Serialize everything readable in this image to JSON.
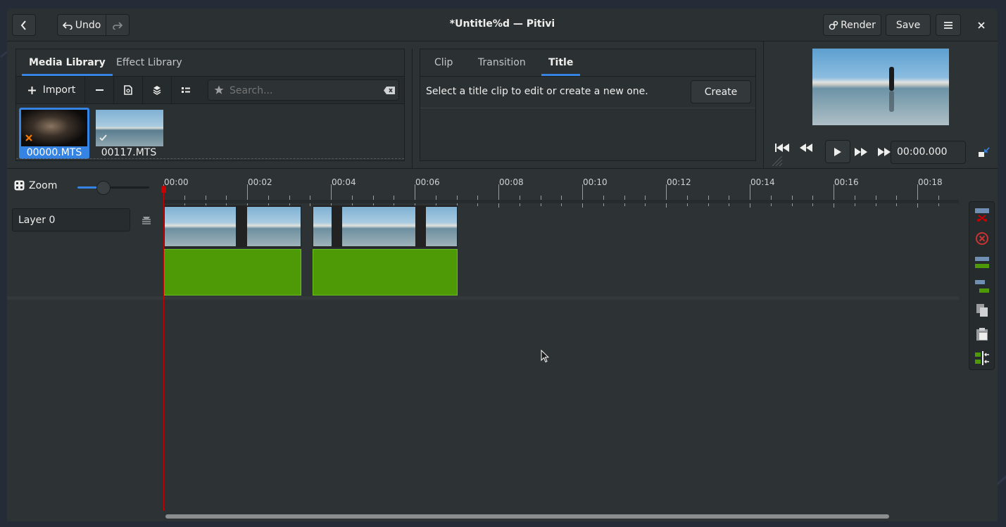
{
  "window": {
    "title": "*Untitle%d — Pitivi"
  },
  "header": {
    "back_icon": "go-back-icon",
    "undo_label": "Undo",
    "redo_icon": "redo-icon",
    "render_label": "Render",
    "save_label": "Save",
    "menu_icon": "hamburger-menu-icon",
    "close_icon": "close-icon"
  },
  "library": {
    "tabs": [
      {
        "label": "Media Library",
        "active": true
      },
      {
        "label": "Effect Library",
        "active": false
      }
    ],
    "import_label": "Import",
    "search_placeholder": "Search...",
    "clips": [
      {
        "name": "00000.MTS",
        "selected": true,
        "status": "error"
      },
      {
        "name": "00117.MTS",
        "selected": false,
        "status": "ok"
      }
    ]
  },
  "context": {
    "tabs": [
      {
        "label": "Clip"
      },
      {
        "label": "Transition"
      },
      {
        "label": "Title",
        "active": true
      }
    ],
    "message": "Select a title clip to edit or create a new one.",
    "create_label": "Create"
  },
  "viewer": {
    "time": "00:00.000"
  },
  "timeline": {
    "zoom_label": "Zoom",
    "zoom_level": 0.33,
    "ruler_labels": [
      "00:00",
      "00:02",
      "00:04",
      "00:06",
      "00:08",
      "00:10",
      "00:12",
      "00:14",
      "00:16",
      "00:18"
    ],
    "layer_label": "Layer 0"
  },
  "colors": {
    "accent": "#3584e4",
    "audio": "#4e9a06",
    "playhead": "#cc0000"
  }
}
